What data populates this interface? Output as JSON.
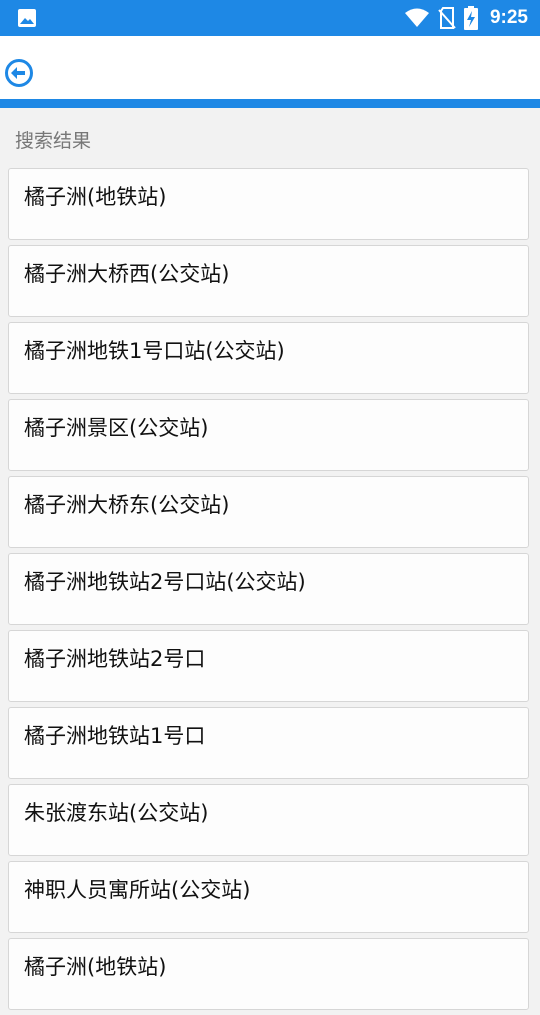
{
  "status_bar": {
    "time": "9:25"
  },
  "section_label": "搜索结果",
  "results": [
    "橘子洲(地铁站)",
    "橘子洲大桥西(公交站)",
    "橘子洲地铁1号口站(公交站)",
    "橘子洲景区(公交站)",
    "橘子洲大桥东(公交站)",
    "橘子洲地铁站2号口站(公交站)",
    "橘子洲地铁站2号口",
    "橘子洲地铁站1号口",
    "朱张渡东站(公交站)",
    "神职人员寓所站(公交站)",
    "橘子洲(地铁站)"
  ],
  "colors": {
    "accent": "#1e88e5"
  }
}
